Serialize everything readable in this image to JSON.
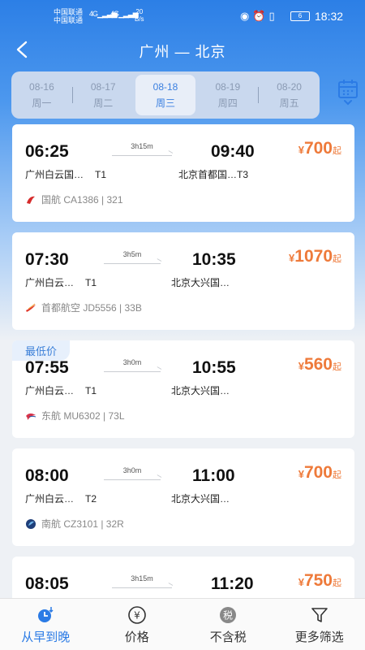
{
  "status_bar": {
    "carrier_1": "中国联通",
    "carrier_2": "中国联通",
    "signal_1": "4G",
    "signal_2": "4G",
    "net_speed_value": "20",
    "net_speed_unit": "B/s",
    "battery": "6",
    "time": "18:32"
  },
  "header": {
    "title": "广州 — 北京"
  },
  "dates": [
    {
      "date": "08-16",
      "weekday": "周一"
    },
    {
      "date": "08-17",
      "weekday": "周二"
    },
    {
      "date": "08-18",
      "weekday": "周三"
    },
    {
      "date": "08-19",
      "weekday": "周四"
    },
    {
      "date": "08-20",
      "weekday": "周五"
    }
  ],
  "flights": [
    {
      "dep_time": "06:25",
      "arr_time": "09:40",
      "duration": "3h15m",
      "dep_airport": "广州白云国…",
      "dep_terminal": "T1",
      "arr_airport": "北京首都国…",
      "arr_terminal": "T3",
      "price_currency": "¥",
      "price": "700",
      "price_suffix": "起",
      "airline": "国航 CA1386 | 321",
      "lowest": ""
    },
    {
      "dep_time": "07:30",
      "arr_time": "10:35",
      "duration": "3h5m",
      "dep_airport": "广州白云…",
      "dep_terminal": "T1",
      "arr_airport": "北京大兴国…",
      "arr_terminal": "",
      "price_currency": "¥",
      "price": "1070",
      "price_suffix": "起",
      "airline": "首都航空 JD5556 | 33B",
      "lowest": ""
    },
    {
      "dep_time": "07:55",
      "arr_time": "10:55",
      "duration": "3h0m",
      "dep_airport": "广州白云…",
      "dep_terminal": "T1",
      "arr_airport": "北京大兴国…",
      "arr_terminal": "",
      "price_currency": "¥",
      "price": "560",
      "price_suffix": "起",
      "airline": "东航 MU6302 | 73L",
      "lowest": "最低价"
    },
    {
      "dep_time": "08:00",
      "arr_time": "11:00",
      "duration": "3h0m",
      "dep_airport": "广州白云…",
      "dep_terminal": "T2",
      "arr_airport": "北京大兴国…",
      "arr_terminal": "",
      "price_currency": "¥",
      "price": "700",
      "price_suffix": "起",
      "airline": "南航 CZ3101 | 32R",
      "lowest": ""
    },
    {
      "dep_time": "08:05",
      "arr_time": "11:20",
      "duration": "3h15m",
      "dep_airport": "",
      "dep_terminal": "",
      "arr_airport": "",
      "arr_terminal": "",
      "price_currency": "¥",
      "price": "750",
      "price_suffix": "起",
      "airline": "",
      "lowest": ""
    }
  ],
  "bottom_nav": [
    {
      "label": "从早到晚",
      "icon": "clock-icon"
    },
    {
      "label": "价格",
      "icon": "yen-icon",
      "glyph": "¥"
    },
    {
      "label": "不含税",
      "icon": "tax-icon",
      "glyph": "税"
    },
    {
      "label": "更多筛选",
      "icon": "filter-icon"
    }
  ],
  "colors": {
    "accent": "#2b7be5",
    "price": "#ee7a3a"
  }
}
